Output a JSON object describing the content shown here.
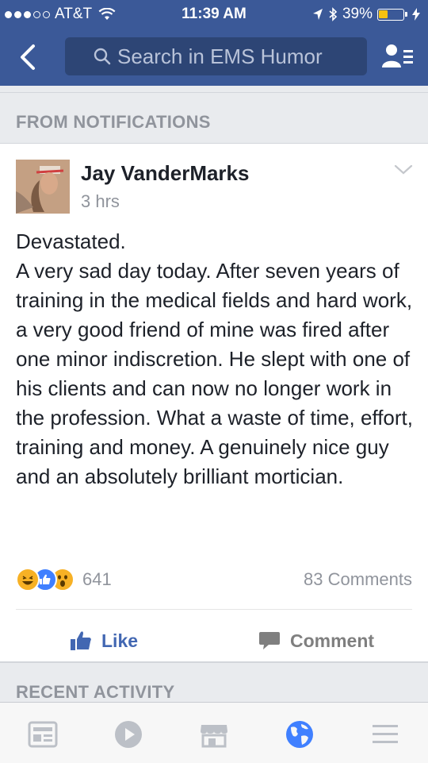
{
  "status_bar": {
    "carrier": "AT&T",
    "time": "11:39 AM",
    "battery": "39%",
    "battery_level": 0.39
  },
  "nav": {
    "search_placeholder": "Search in EMS Humor",
    "back_icon": "chevron-left-icon",
    "friends_icon": "friend-requests-icon"
  },
  "sections": {
    "notifications_header": "FROM NOTIFICATIONS",
    "recent_activity_header": "RECENT ACTIVITY"
  },
  "post": {
    "author": "Jay VanderMarks",
    "time": "3 hrs",
    "text": "Devastated.\nA very sad day today. After seven years of training in the medical fields and hard work, a very good friend of mine was fired after one minor indiscretion. He slept with one of his clients and can now no longer work in the profession. What a waste of time, effort, training and money. A genuinely nice guy and an absolutely brilliant mortician.",
    "reactions_count": "641",
    "reaction_types": [
      "haha",
      "like",
      "wow"
    ],
    "comments_count": "83 Comments",
    "like_label": "Like",
    "comment_label": "Comment"
  },
  "tabs": [
    "news-feed-icon",
    "video-icon",
    "marketplace-icon",
    "notifications-globe-icon",
    "menu-icon"
  ],
  "colors": {
    "brand_blue": "#3b5998",
    "like_blue": "#4267b2",
    "active_tab": "#4080ff",
    "inactive_tab": "#bcc0c7"
  }
}
